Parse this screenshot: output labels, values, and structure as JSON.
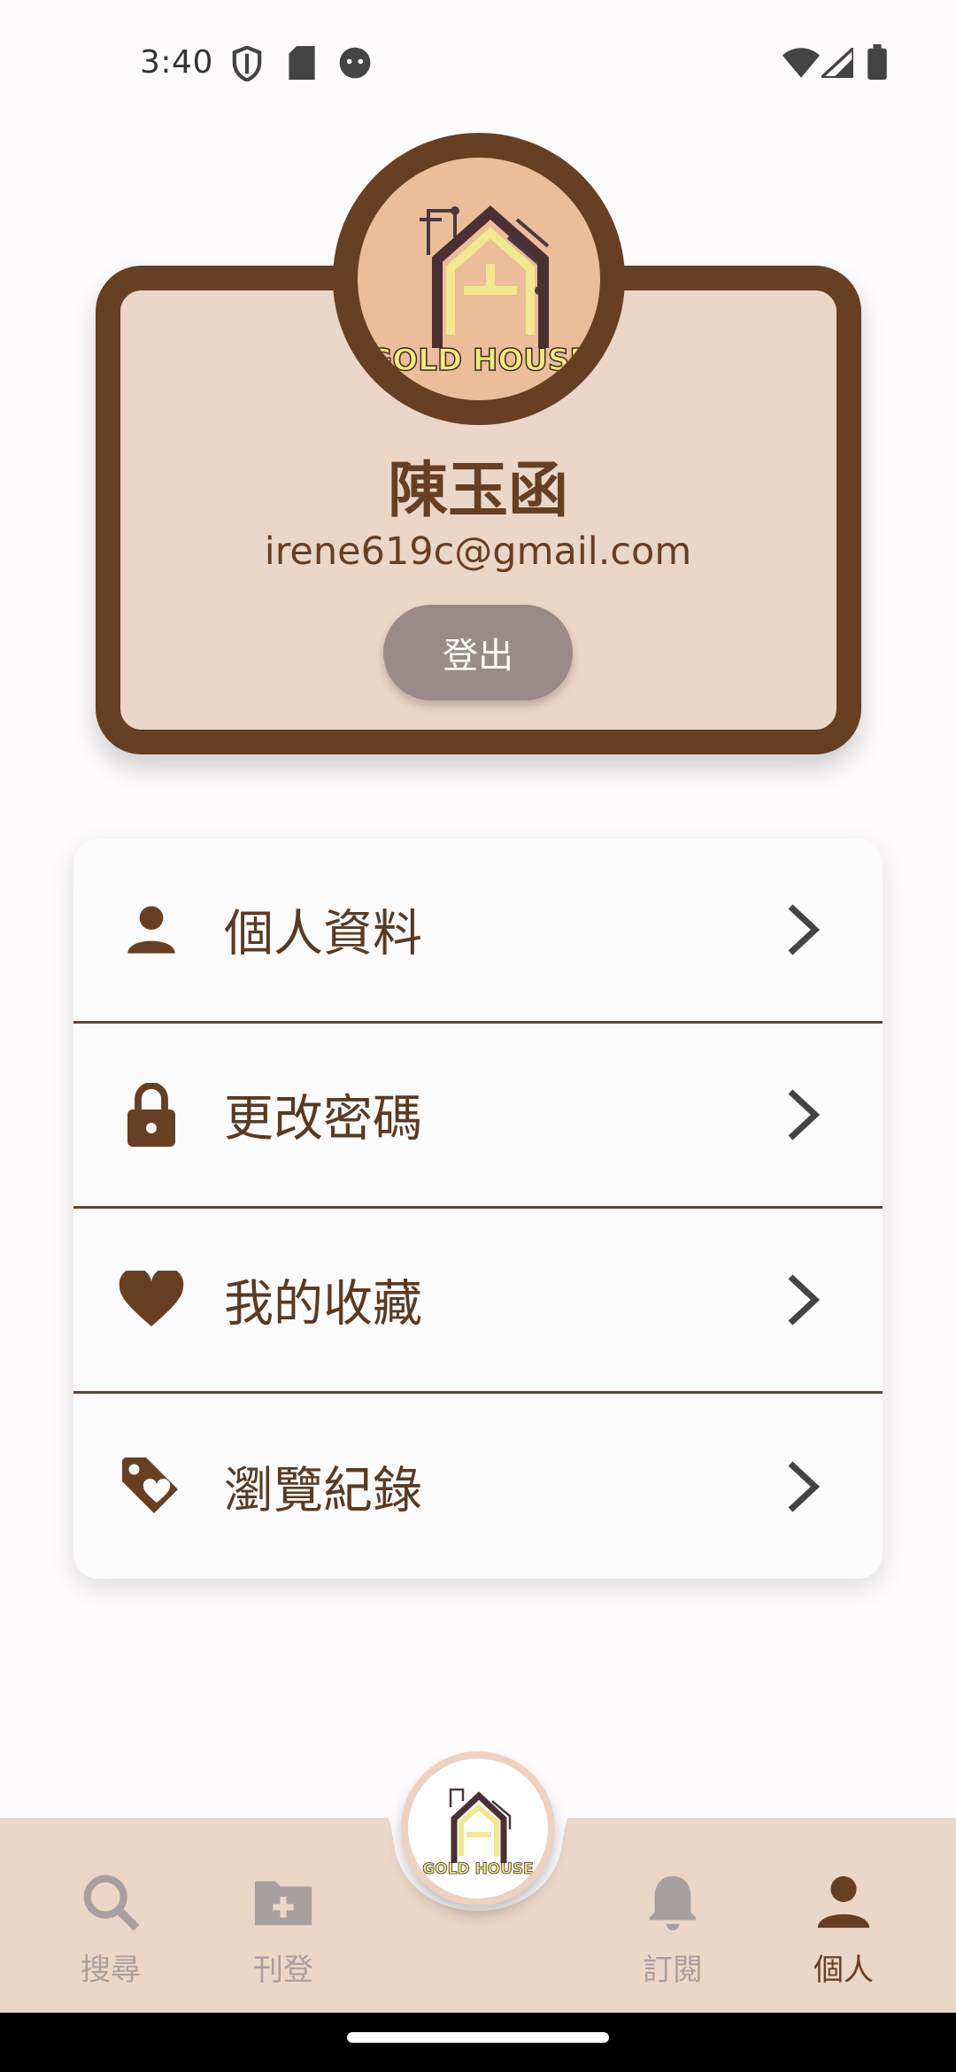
{
  "status_bar": {
    "time": "3:40"
  },
  "profile": {
    "name": "陳玉函",
    "email": "irene619c@gmail.com",
    "logout_label": "登出",
    "logo_text": "GOLD HOUSE"
  },
  "menu": {
    "items": [
      {
        "label": "個人資料",
        "icon": "person-icon"
      },
      {
        "label": "更改密碼",
        "icon": "lock-icon"
      },
      {
        "label": "我的收藏",
        "icon": "heart-icon"
      },
      {
        "label": "瀏覽紀錄",
        "icon": "tag-heart-icon"
      }
    ]
  },
  "bottom_nav": {
    "items": [
      {
        "label": "搜尋",
        "icon": "search-icon",
        "active": false
      },
      {
        "label": "刊登",
        "icon": "folder-add-icon",
        "active": false
      },
      {
        "label": "訂閱",
        "icon": "bell-icon",
        "active": false
      },
      {
        "label": "個人",
        "icon": "person-icon",
        "active": true
      }
    ]
  },
  "colors": {
    "brand_brown": "#673f23",
    "card_beige": "#ead7c7",
    "avatar_peach": "#ebbd99",
    "logout_gray": "#998b87",
    "inactive_nav": "#a8a0a0"
  }
}
